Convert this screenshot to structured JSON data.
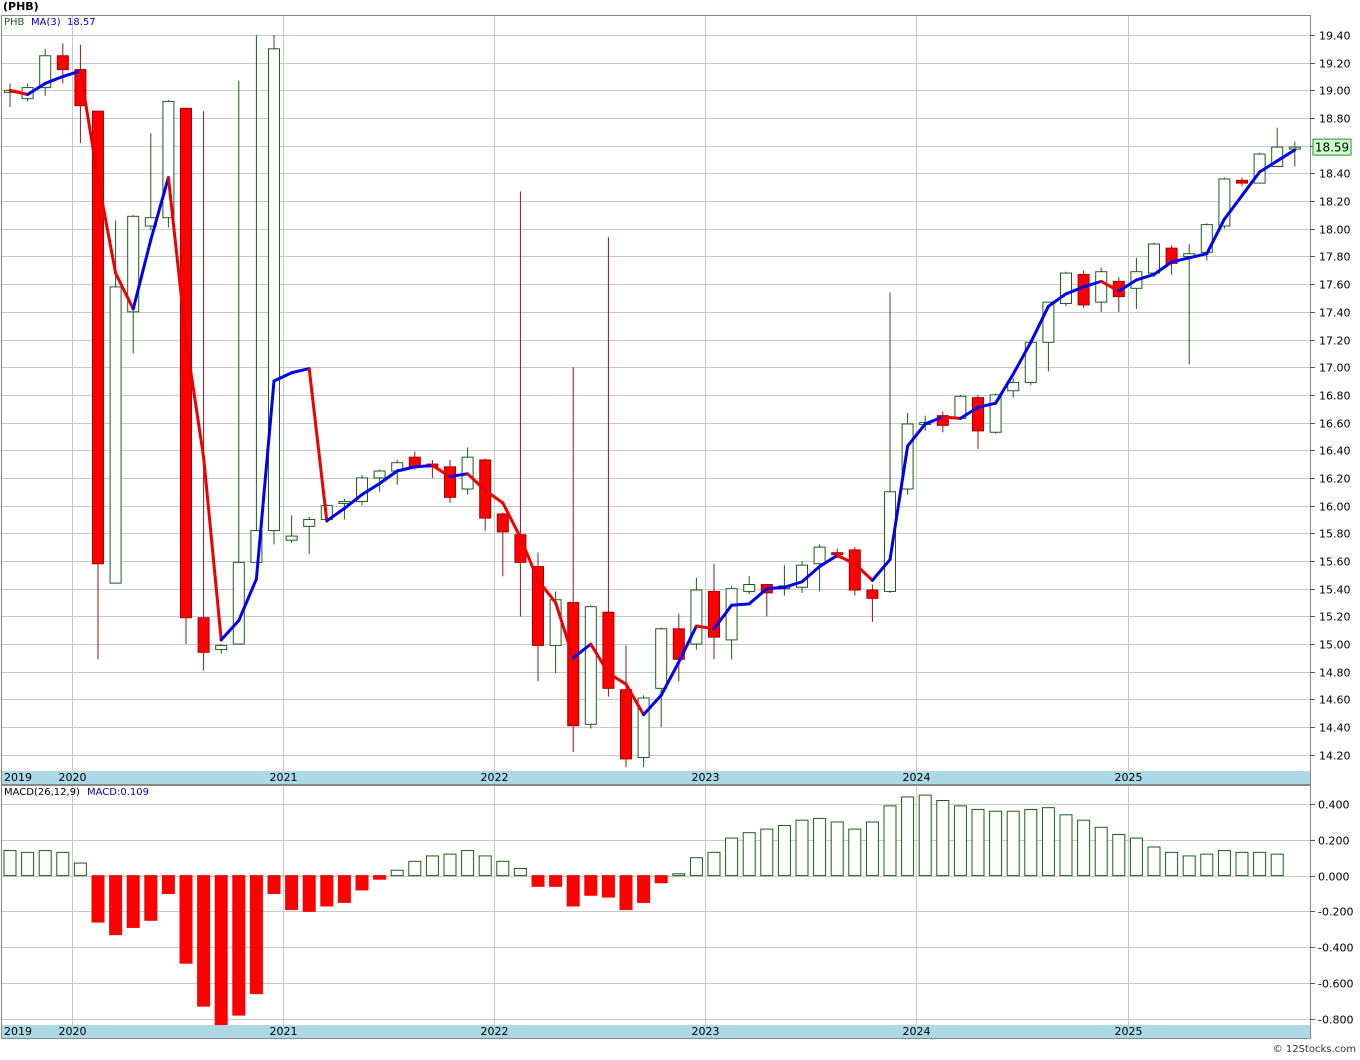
{
  "symbol_title": "(PHB)",
  "credit": "© 12Stocks.com",
  "colors": {
    "up_candle_stroke": "#1a5e1a",
    "down_candle": "#ff0000",
    "ma_up": "#0000ee",
    "ma_down": "#ee0000",
    "grid": "#c8c8c8",
    "axis_strip": "#add8e6",
    "last_price_box": "#ccffcc",
    "macd_pos": "#1a5e1a",
    "macd_neg": "#ff0000"
  },
  "chart_data": [
    {
      "type": "candlestick",
      "legend": {
        "symbol": "PHB",
        "ma_label": "MA(3)",
        "ma_value": "18.57"
      },
      "last_price": "18.59",
      "x_labels": [
        "2019",
        "2020",
        "2021",
        "2022",
        "2023",
        "2024",
        "2025"
      ],
      "y_ticks": [
        "14.20",
        "14.40",
        "14.60",
        "14.80",
        "15.00",
        "15.20",
        "15.40",
        "15.60",
        "15.80",
        "16.00",
        "16.20",
        "16.40",
        "16.60",
        "16.80",
        "17.00",
        "17.20",
        "17.40",
        "17.60",
        "17.80",
        "18.00",
        "18.20",
        "18.40",
        "18.60",
        "18.80",
        "19.00",
        "19.20",
        "19.40"
      ],
      "ylim": [
        14.09,
        19.53
      ],
      "x_index_range": [
        0,
        81
      ],
      "year_starts": [
        {
          "label": "2019",
          "i": 0
        },
        {
          "label": "2020",
          "i": 3.5
        },
        {
          "label": "2021",
          "i": 15.5
        },
        {
          "label": "2022",
          "i": 27.5
        },
        {
          "label": "2023",
          "i": 39.5
        },
        {
          "label": "2024",
          "i": 51.5
        },
        {
          "label": "2025",
          "i": 63.5
        }
      ],
      "candles": [
        {
          "t": "2019-10",
          "o": 19.0,
          "h": 19.05,
          "l": 18.88,
          "c": 19.0
        },
        {
          "t": "2019-11",
          "o": 18.94,
          "h": 19.05,
          "l": 18.92,
          "c": 19.02
        },
        {
          "t": "2019-12",
          "o": 19.02,
          "h": 19.3,
          "l": 18.96,
          "c": 19.25
        },
        {
          "t": "2020-01",
          "o": 19.25,
          "h": 19.34,
          "l": 19.05,
          "c": 19.15
        },
        {
          "t": "2020-02",
          "o": 19.15,
          "h": 19.33,
          "l": 18.62,
          "c": 18.89
        },
        {
          "t": "2020-03",
          "o": 18.85,
          "h": 18.85,
          "l": 14.89,
          "c": 15.58
        },
        {
          "t": "2020-04",
          "o": 15.44,
          "h": 18.06,
          "l": 16.1,
          "c": 17.58
        },
        {
          "t": "2020-05",
          "o": 17.4,
          "h": 18.1,
          "l": 17.1,
          "c": 18.09
        },
        {
          "t": "2020-06",
          "o": 18.02,
          "h": 18.69,
          "l": 17.99,
          "c": 18.08
        },
        {
          "t": "2020-07",
          "o": 18.08,
          "h": 18.93,
          "l": 18.01,
          "c": 18.92
        },
        {
          "t": "2020-08",
          "o": 18.87,
          "h": 18.87,
          "l": 15.0,
          "c": 15.19
        },
        {
          "t": "2020-09",
          "o": 15.19,
          "h": 18.85,
          "l": 14.81,
          "c": 14.94
        },
        {
          "t": "2020-10",
          "o": 14.96,
          "h": 15.0,
          "l": 14.93,
          "c": 14.99
        },
        {
          "t": "2020-11",
          "o": 15.0,
          "h": 19.07,
          "l": 15.0,
          "c": 15.59
        },
        {
          "t": "2020-12",
          "o": 15.59,
          "h": 19.4,
          "l": 15.59,
          "c": 15.82
        },
        {
          "t": "2021-01",
          "o": 15.82,
          "h": 19.4,
          "l": 15.72,
          "c": 19.3
        },
        {
          "t": "2021-02",
          "o": 15.75,
          "h": 15.93,
          "l": 15.73,
          "c": 15.78
        },
        {
          "t": "2021-03",
          "o": 15.85,
          "h": 15.92,
          "l": 15.65,
          "c": 15.9
        },
        {
          "t": "2021-04",
          "o": 15.9,
          "h": 16.01,
          "l": 15.88,
          "c": 16.0
        },
        {
          "t": "2021-05",
          "o": 16.02,
          "h": 16.05,
          "l": 15.9,
          "c": 16.03
        },
        {
          "t": "2021-06",
          "o": 16.03,
          "h": 16.22,
          "l": 16.0,
          "c": 16.2
        },
        {
          "t": "2021-07",
          "o": 16.2,
          "h": 16.26,
          "l": 16.1,
          "c": 16.25
        },
        {
          "t": "2021-08",
          "o": 16.25,
          "h": 16.33,
          "l": 16.15,
          "c": 16.31
        },
        {
          "t": "2021-09",
          "o": 16.35,
          "h": 16.39,
          "l": 16.26,
          "c": 16.28
        },
        {
          "t": "2021-10",
          "o": 16.3,
          "h": 16.33,
          "l": 16.2,
          "c": 16.28
        },
        {
          "t": "2021-11",
          "o": 16.28,
          "h": 16.33,
          "l": 16.02,
          "c": 16.06
        },
        {
          "t": "2021-12",
          "o": 16.12,
          "h": 16.42,
          "l": 16.08,
          "c": 16.35
        },
        {
          "t": "2022-01",
          "o": 16.33,
          "h": 16.34,
          "l": 15.82,
          "c": 15.91
        },
        {
          "t": "2022-02",
          "o": 15.94,
          "h": 15.95,
          "l": 15.49,
          "c": 15.81
        },
        {
          "t": "2022-03",
          "o": 15.79,
          "h": 18.27,
          "l": 15.2,
          "c": 15.59
        },
        {
          "t": "2022-04",
          "o": 15.56,
          "h": 15.66,
          "l": 14.73,
          "c": 14.99
        },
        {
          "t": "2022-05",
          "o": 14.99,
          "h": 15.38,
          "l": 14.79,
          "c": 15.32
        },
        {
          "t": "2022-06",
          "o": 15.3,
          "h": 17.0,
          "l": 14.22,
          "c": 14.41
        },
        {
          "t": "2022-07",
          "o": 14.42,
          "h": 15.28,
          "l": 14.39,
          "c": 15.27
        },
        {
          "t": "2022-08",
          "o": 15.23,
          "h": 17.94,
          "l": 14.62,
          "c": 14.68
        },
        {
          "t": "2022-09",
          "o": 14.67,
          "h": 14.99,
          "l": 14.11,
          "c": 14.17
        },
        {
          "t": "2022-10",
          "o": 14.18,
          "h": 14.63,
          "l": 14.11,
          "c": 14.61
        },
        {
          "t": "2022-11",
          "o": 14.68,
          "h": 15.12,
          "l": 14.4,
          "c": 15.11
        },
        {
          "t": "2022-12",
          "o": 15.11,
          "h": 15.22,
          "l": 14.73,
          "c": 14.89
        },
        {
          "t": "2023-01",
          "o": 15.0,
          "h": 15.48,
          "l": 14.96,
          "c": 15.39
        },
        {
          "t": "2023-02",
          "o": 15.38,
          "h": 15.58,
          "l": 14.89,
          "c": 15.05
        },
        {
          "t": "2023-03",
          "o": 15.03,
          "h": 15.42,
          "l": 14.89,
          "c": 15.4
        },
        {
          "t": "2023-04",
          "o": 15.38,
          "h": 15.49,
          "l": 15.36,
          "c": 15.43
        },
        {
          "t": "2023-05",
          "o": 15.43,
          "h": 15.4,
          "l": 15.2,
          "c": 15.37
        },
        {
          "t": "2023-06",
          "o": 15.4,
          "h": 15.57,
          "l": 15.35,
          "c": 15.42
        },
        {
          "t": "2023-07",
          "o": 15.41,
          "h": 15.6,
          "l": 15.37,
          "c": 15.57
        },
        {
          "t": "2023-08",
          "o": 15.58,
          "h": 15.72,
          "l": 15.38,
          "c": 15.7
        },
        {
          "t": "2023-09",
          "o": 15.66,
          "h": 15.69,
          "l": 15.62,
          "c": 15.65
        },
        {
          "t": "2023-10",
          "o": 15.68,
          "h": 15.7,
          "l": 15.35,
          "c": 15.39
        },
        {
          "t": "2023-11",
          "o": 15.39,
          "h": 15.43,
          "l": 15.16,
          "c": 15.33
        },
        {
          "t": "2023-12",
          "o": 15.38,
          "h": 17.54,
          "l": 15.37,
          "c": 16.1
        },
        {
          "t": "2024-01",
          "o": 16.12,
          "h": 16.67,
          "l": 16.08,
          "c": 16.59
        },
        {
          "t": "2024-02",
          "o": 16.59,
          "h": 16.65,
          "l": 16.54,
          "c": 16.6
        },
        {
          "t": "2024-03",
          "o": 16.65,
          "h": 16.68,
          "l": 16.53,
          "c": 16.58
        },
        {
          "t": "2024-04",
          "o": 16.63,
          "h": 16.8,
          "l": 16.62,
          "c": 16.79
        },
        {
          "t": "2024-05",
          "o": 16.78,
          "h": 16.8,
          "l": 16.41,
          "c": 16.54
        },
        {
          "t": "2024-06",
          "o": 16.53,
          "h": 16.81,
          "l": 16.52,
          "c": 16.8
        },
        {
          "t": "2024-07",
          "o": 16.83,
          "h": 16.92,
          "l": 16.78,
          "c": 16.89
        },
        {
          "t": "2024-08",
          "o": 16.89,
          "h": 17.18,
          "l": 16.87,
          "c": 17.18
        },
        {
          "t": "2024-09",
          "o": 17.18,
          "h": 17.47,
          "l": 16.97,
          "c": 17.47
        },
        {
          "t": "2024-10",
          "o": 17.46,
          "h": 17.69,
          "l": 17.44,
          "c": 17.68
        },
        {
          "t": "2024-11",
          "o": 17.67,
          "h": 17.7,
          "l": 17.43,
          "c": 17.45
        },
        {
          "t": "2024-12",
          "o": 17.47,
          "h": 17.72,
          "l": 17.4,
          "c": 17.69
        },
        {
          "t": "2025-01",
          "o": 17.62,
          "h": 17.65,
          "l": 17.4,
          "c": 17.51
        },
        {
          "t": "2025-02",
          "o": 17.57,
          "h": 17.79,
          "l": 17.42,
          "c": 17.69
        },
        {
          "t": "2025-03",
          "o": 17.68,
          "h": 17.9,
          "l": 17.65,
          "c": 17.89
        },
        {
          "t": "2025-04",
          "o": 17.86,
          "h": 17.88,
          "l": 17.67,
          "c": 17.75
        },
        {
          "t": "2025-05",
          "o": 17.8,
          "h": 17.89,
          "l": 17.02,
          "c": 17.82
        },
        {
          "t": "2025-06",
          "o": 17.83,
          "h": 18.04,
          "l": 17.77,
          "c": 18.03
        },
        {
          "t": "2025-07",
          "o": 18.02,
          "h": 18.37,
          "l": 18.0,
          "c": 18.36
        },
        {
          "t": "2025-08",
          "o": 18.35,
          "h": 18.37,
          "l": 18.31,
          "c": 18.33
        },
        {
          "t": "2025-09",
          "o": 18.33,
          "h": 18.55,
          "l": 18.33,
          "c": 18.54
        },
        {
          "t": "2025-10",
          "o": 18.45,
          "h": 18.73,
          "l": 18.45,
          "c": 18.59
        },
        {
          "t": "2025-11",
          "o": 18.58,
          "h": 18.63,
          "l": 18.45,
          "c": 18.59
        }
      ],
      "ma3": [
        {
          "t": "2019-10",
          "v": 19.0
        },
        {
          "t": "2019-11",
          "v": 18.97
        },
        {
          "t": "2019-12",
          "v": 19.05
        },
        {
          "t": "2020-01",
          "v": 19.1
        },
        {
          "t": "2020-02",
          "v": 19.14
        },
        {
          "t": "2020-03",
          "v": 18.36
        },
        {
          "t": "2020-04",
          "v": 17.68
        },
        {
          "t": "2020-05",
          "v": 17.42
        },
        {
          "t": "2020-06",
          "v": 17.92
        },
        {
          "t": "2020-07",
          "v": 18.37
        },
        {
          "t": "2020-08",
          "v": 17.2
        },
        {
          "t": "2020-09",
          "v": 16.35
        },
        {
          "t": "2020-10",
          "v": 15.03
        },
        {
          "t": "2020-11",
          "v": 15.17
        },
        {
          "t": "2020-12",
          "v": 15.47
        },
        {
          "t": "2021-01",
          "v": 16.9
        },
        {
          "t": "2021-02",
          "v": 16.96
        },
        {
          "t": "2021-03",
          "v": 16.99
        },
        {
          "t": "2021-04",
          "v": 15.89
        },
        {
          "t": "2021-05",
          "v": 15.98
        },
        {
          "t": "2021-06",
          "v": 16.08
        },
        {
          "t": "2021-07",
          "v": 16.16
        },
        {
          "t": "2021-08",
          "v": 16.25
        },
        {
          "t": "2021-09",
          "v": 16.28
        },
        {
          "t": "2021-10",
          "v": 16.29
        },
        {
          "t": "2021-11",
          "v": 16.21
        },
        {
          "t": "2021-12",
          "v": 16.23
        },
        {
          "t": "2022-01",
          "v": 16.11
        },
        {
          "t": "2022-02",
          "v": 16.02
        },
        {
          "t": "2022-03",
          "v": 15.77
        },
        {
          "t": "2022-04",
          "v": 15.46
        },
        {
          "t": "2022-05",
          "v": 15.3
        },
        {
          "t": "2022-06",
          "v": 14.9
        },
        {
          "t": "2022-07",
          "v": 15.0
        },
        {
          "t": "2022-08",
          "v": 14.79
        },
        {
          "t": "2022-09",
          "v": 14.71
        },
        {
          "t": "2022-10",
          "v": 14.49
        },
        {
          "t": "2022-11",
          "v": 14.63
        },
        {
          "t": "2022-12",
          "v": 14.87
        },
        {
          "t": "2023-01",
          "v": 15.13
        },
        {
          "t": "2023-02",
          "v": 15.11
        },
        {
          "t": "2023-03",
          "v": 15.28
        },
        {
          "t": "2023-04",
          "v": 15.29
        },
        {
          "t": "2023-05",
          "v": 15.4
        },
        {
          "t": "2023-06",
          "v": 15.41
        },
        {
          "t": "2023-07",
          "v": 15.45
        },
        {
          "t": "2023-08",
          "v": 15.56
        },
        {
          "t": "2023-09",
          "v": 15.64
        },
        {
          "t": "2023-10",
          "v": 15.58
        },
        {
          "t": "2023-11",
          "v": 15.46
        },
        {
          "t": "2023-12",
          "v": 15.61
        },
        {
          "t": "2024-01",
          "v": 16.43
        },
        {
          "t": "2024-02",
          "v": 16.59
        },
        {
          "t": "2024-03",
          "v": 16.64
        },
        {
          "t": "2024-04",
          "v": 16.63
        },
        {
          "t": "2024-05",
          "v": 16.71
        },
        {
          "t": "2024-06",
          "v": 16.74
        },
        {
          "t": "2024-07",
          "v": 16.95
        },
        {
          "t": "2024-08",
          "v": 17.18
        },
        {
          "t": "2024-09",
          "v": 17.44
        },
        {
          "t": "2024-10",
          "v": 17.53
        },
        {
          "t": "2024-11",
          "v": 17.58
        },
        {
          "t": "2024-12",
          "v": 17.62
        },
        {
          "t": "2025-01",
          "v": 17.55
        },
        {
          "t": "2025-02",
          "v": 17.63
        },
        {
          "t": "2025-03",
          "v": 17.67
        },
        {
          "t": "2025-04",
          "v": 17.76
        },
        {
          "t": "2025-05",
          "v": 17.79
        },
        {
          "t": "2025-06",
          "v": 17.82
        },
        {
          "t": "2025-07",
          "v": 18.07
        },
        {
          "t": "2025-08",
          "v": 18.24
        },
        {
          "t": "2025-09",
          "v": 18.41
        },
        {
          "t": "2025-10",
          "v": 18.49
        },
        {
          "t": "2025-11",
          "v": 18.57
        }
      ]
    },
    {
      "type": "bar",
      "legend": {
        "label": "MACD(26,12,9)",
        "macd_label": "MACD:0.109"
      },
      "x_labels": [
        "2019",
        "2020",
        "2021",
        "2022",
        "2023",
        "2024",
        "2025"
      ],
      "y_ticks": [
        "-0.800",
        "-0.600",
        "-0.400",
        "-0.200",
        "0.000",
        "0.200",
        "0.400"
      ],
      "ylim": [
        -0.83,
        0.49
      ],
      "values": [
        0.14,
        0.13,
        0.14,
        0.13,
        0.07,
        -0.26,
        -0.33,
        -0.29,
        -0.25,
        -0.1,
        -0.49,
        -0.73,
        -0.84,
        -0.78,
        -0.66,
        -0.1,
        -0.19,
        -0.2,
        -0.17,
        -0.15,
        -0.08,
        -0.02,
        0.03,
        0.08,
        0.11,
        0.12,
        0.14,
        0.11,
        0.08,
        0.04,
        -0.06,
        -0.06,
        -0.17,
        -0.11,
        -0.12,
        -0.19,
        -0.15,
        -0.04,
        0.01,
        0.1,
        0.13,
        0.21,
        0.24,
        0.26,
        0.28,
        0.31,
        0.32,
        0.3,
        0.26,
        0.3,
        0.39,
        0.44,
        0.45,
        0.42,
        0.39,
        0.37,
        0.36,
        0.36,
        0.37,
        0.38,
        0.34,
        0.31,
        0.27,
        0.23,
        0.21,
        0.16,
        0.13,
        0.11,
        0.12,
        0.14,
        0.13,
        0.13,
        0.12
      ]
    }
  ]
}
